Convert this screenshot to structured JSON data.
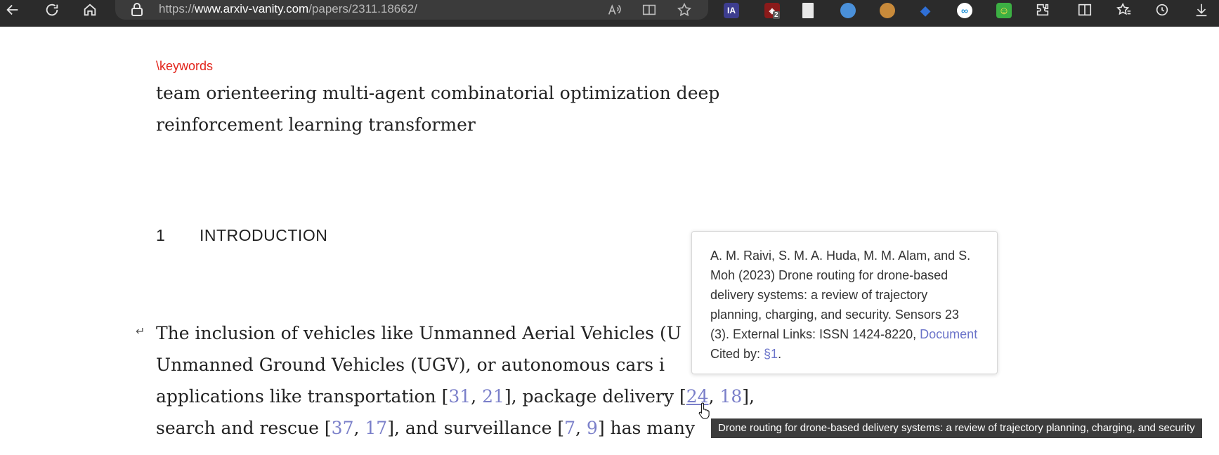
{
  "browser": {
    "url_prefix": "https://",
    "url_host": "www.arxiv-vanity.com",
    "url_path": "/papers/2311.18662/",
    "extensions": [
      {
        "name": "ia-extension",
        "label": "IA",
        "color": "#3d3d8f"
      },
      {
        "name": "ublock-extension",
        "label": "",
        "badge": "2",
        "color": "#8b1a1a"
      },
      {
        "name": "document-extension",
        "label": "",
        "color": "#e8e8e8"
      },
      {
        "name": "colorful-extension",
        "label": "",
        "color": "#4a90d9"
      },
      {
        "name": "cookie-extension",
        "label": "",
        "color": "#c88a3a"
      },
      {
        "name": "cap-extension",
        "label": "",
        "color": "#2f6fd6"
      },
      {
        "name": "circle-extension",
        "label": "",
        "color": "#1c8fd6"
      },
      {
        "name": "smiley-extension",
        "label": "",
        "color": "#3cb043"
      }
    ]
  },
  "paper": {
    "keywords_label": "\\keywords",
    "keywords_line1": "team orienteering multi-agent combinatorial optimization deep",
    "keywords_line2": "reinforcement learning transformer",
    "section_number": "1",
    "section_title": "INTRODUCTION",
    "lines": {
      "l1": "The inclusion of vehicles like Unmanned Aerial Vehicles (U",
      "l2": "Unmanned Ground Vehicles (UGV), or autonomous cars i",
      "l3_a": "applications like transportation [",
      "l3_c1": "31",
      "l3_sep1": ", ",
      "l3_c2": "21",
      "l3_b": "], package delivery [",
      "l3_c3": "24",
      "l3_sep2": ", ",
      "l3_c4": "18",
      "l3_end": "],",
      "l4_a": "search and rescue [",
      "l4_c1": "37",
      "l4_sep1": ", ",
      "l4_c2": "17",
      "l4_b": "], and surveillance [",
      "l4_c3": "7",
      "l4_sep2": ", ",
      "l4_c4": "9",
      "l4_end": "] has many"
    }
  },
  "popover": {
    "text_main": "A. M. Raivi, S. M. A. Huda, M. M. Alam, and S. Moh (2023) Drone routing for drone-based delivery systems: a review of trajectory planning, charging, and security. Sensors 23 (3). External Links: ISSN 1424-8220, ",
    "link_document": "Document",
    "cited_by_label": " Cited by: ",
    "cited_by_link": "§1",
    "trailing": "."
  },
  "tooltip": {
    "text": "Drone routing for drone-based delivery systems: a review of trajectory planning, charging, and security"
  }
}
